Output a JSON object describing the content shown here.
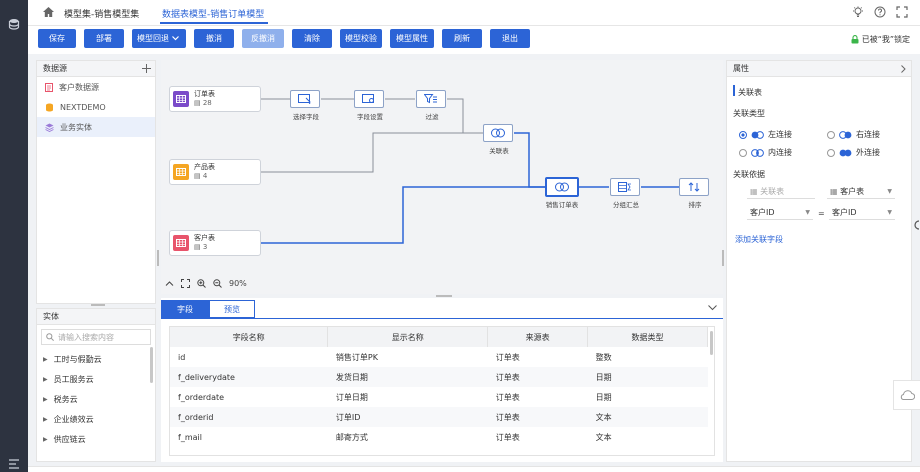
{
  "breadcrumb": {
    "parent": "模型集-销售模型集",
    "current": "数据表模型-销售订单模型"
  },
  "toolbar": {
    "save": "保存",
    "deploy": "部署",
    "rollback": "模型回退",
    "undo": "撤消",
    "redo": "反撤消",
    "clear": "清除",
    "validate": "模型校验",
    "props": "模型属性",
    "refresh": "刷新",
    "exit": "退出",
    "lock_text": "已被“我”锁定"
  },
  "datasource": {
    "title": "数据源",
    "items": [
      {
        "label": "客户数据源"
      },
      {
        "label": "NEXTDEMO"
      },
      {
        "label": "业务实体"
      }
    ]
  },
  "entity": {
    "title": "实体",
    "search_placeholder": "请输入搜索内容",
    "items": [
      {
        "label": "工时与假勤云"
      },
      {
        "label": "员工服务云"
      },
      {
        "label": "税务云"
      },
      {
        "label": "企业绩效云"
      },
      {
        "label": "供应链云"
      }
    ]
  },
  "canvas": {
    "tables": [
      {
        "name": "订单表",
        "count": "28",
        "color": "#7b4bc9"
      },
      {
        "name": "产品表",
        "count": "4",
        "color": "#f5a623"
      },
      {
        "name": "客户表",
        "count": "3",
        "color": "#e8546b"
      }
    ],
    "ops": {
      "select": "选择字段",
      "setting": "字段设置",
      "filter": "过滤",
      "join1": "关联表",
      "result": "销售订单表",
      "group": "分组汇总",
      "sort": "排序"
    },
    "zoom": "90%"
  },
  "bottom": {
    "tabs": {
      "fields": "字段",
      "preview": "预览"
    },
    "columns": [
      "字段名称",
      "显示名称",
      "来源表",
      "数据类型"
    ],
    "rows": [
      [
        "id",
        "销售订单PK",
        "订单表",
        "整数"
      ],
      [
        "f_deliverydate",
        "发货日期",
        "订单表",
        "日期"
      ],
      [
        "f_orderdate",
        "订单日期",
        "订单表",
        "日期"
      ],
      [
        "f_orderid",
        "订单ID",
        "订单表",
        "文本"
      ],
      [
        "f_mail",
        "邮寄方式",
        "订单表",
        "文本"
      ]
    ]
  },
  "props": {
    "title": "属性",
    "section": "关联表",
    "join_type_label": "关联类型",
    "left_join": "左连接",
    "right_join": "右连接",
    "inner_join": "内连接",
    "outer_join": "外连接",
    "basis_label": "关联依据",
    "left_table": "关联表",
    "right_table": "客户表",
    "left_field": "客户ID",
    "op": "=",
    "right_field": "客户ID",
    "add_field": "添加关联字段"
  },
  "colors": {
    "accent": "#2c64d6",
    "rail": "#2d3340"
  }
}
